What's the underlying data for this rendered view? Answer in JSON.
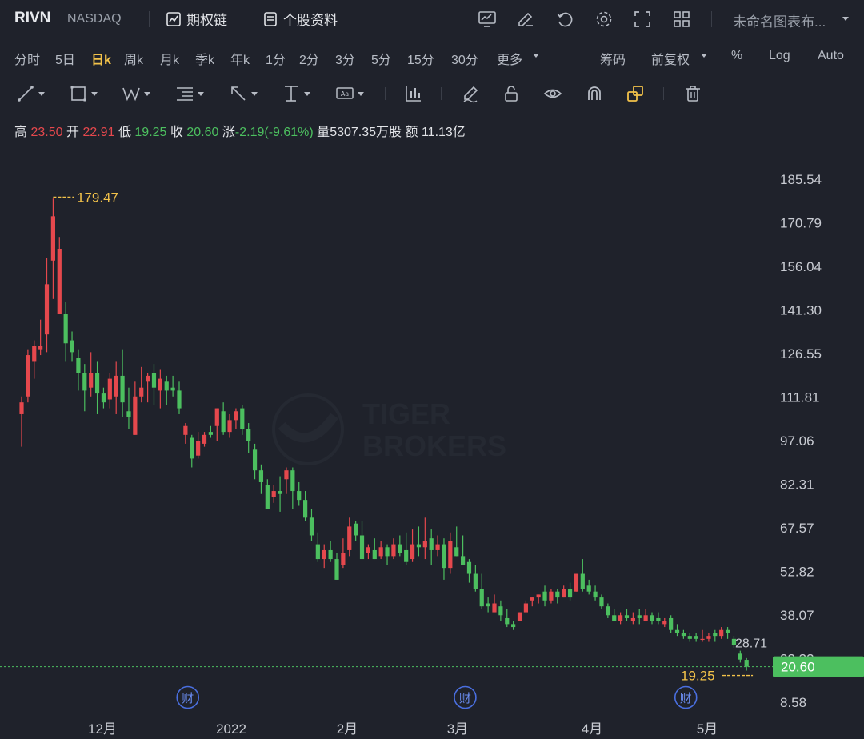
{
  "header": {
    "ticker": "RIVN",
    "exchange": "NASDAQ",
    "options_chain_label": "期权链",
    "profile_label": "个股资料",
    "chart_name": "未命名图表布..."
  },
  "periods": {
    "items": [
      "分时",
      "5日",
      "日k",
      "周k",
      "月k",
      "季k",
      "年k",
      "1分",
      "2分",
      "3分",
      "5分",
      "15分",
      "30分",
      "更多"
    ],
    "active": "日k"
  },
  "right_options": {
    "chips": "筹码",
    "adjust": "前复权",
    "percent": "%",
    "log": "Log",
    "auto": "Auto"
  },
  "quote": {
    "high_label": "高",
    "high": "23.50",
    "open_label": "开",
    "open": "22.91",
    "low_label": "低",
    "low": "19.25",
    "close_label": "收",
    "close": "20.60",
    "change_label": "涨",
    "change": "-2.19(-9.61%)",
    "volume_label": "量",
    "volume": "5307.35万股",
    "amount_label": "额",
    "amount": "11.13亿"
  },
  "colors": {
    "up": "#e5484d",
    "down": "#4cbf5f",
    "highlight": "#f2c24a",
    "accent": "#f2c24a"
  },
  "watermark": {
    "line1": "TIGER",
    "line2": "BROKERS"
  },
  "chart_data": {
    "type": "candlestick",
    "y_ticks": [
      "185.54",
      "170.79",
      "156.04",
      "141.30",
      "126.55",
      "111.81",
      "97.06",
      "82.31",
      "67.57",
      "52.82",
      "38.07",
      "23.33",
      "8.58"
    ],
    "ylim": [
      8.58,
      185.54
    ],
    "x_ticks": [
      "12月",
      "2022",
      "2月",
      "3月",
      "4月",
      "5月"
    ],
    "max_label": "179.47",
    "min_label": "19.25",
    "last_price": "20.60",
    "side_label": "28.71",
    "event_marker": "财",
    "event_x_indices": [
      19,
      63,
      98
    ],
    "candles": [
      [
        106,
        110,
        95,
        112
      ],
      [
        112,
        126,
        110,
        128
      ],
      [
        124,
        129,
        118,
        131
      ],
      [
        128,
        129,
        126,
        138
      ],
      [
        133,
        150,
        127,
        159
      ],
      [
        158,
        173,
        145,
        179
      ],
      [
        140,
        162,
        140,
        166
      ],
      [
        140,
        130,
        124,
        144
      ],
      [
        131,
        127,
        124,
        134
      ],
      [
        125,
        120,
        114,
        128
      ],
      [
        120,
        114,
        107,
        123
      ],
      [
        115,
        120,
        112,
        127
      ],
      [
        120,
        113,
        106,
        124
      ],
      [
        113,
        110,
        108,
        115
      ],
      [
        111,
        118,
        108,
        120
      ],
      [
        112,
        119,
        106,
        124
      ],
      [
        119,
        110,
        105,
        128
      ],
      [
        107,
        105,
        101,
        115
      ],
      [
        99,
        112,
        99,
        117
      ],
      [
        112,
        115,
        110,
        122
      ],
      [
        117,
        119,
        110,
        120
      ],
      [
        120,
        115,
        109,
        123
      ],
      [
        114,
        118,
        108,
        121
      ],
      [
        117,
        114,
        109,
        119
      ],
      [
        115,
        114,
        112,
        119
      ],
      [
        114,
        108,
        106,
        117
      ],
      [
        99,
        102,
        96,
        103
      ],
      [
        98,
        91,
        88,
        99
      ],
      [
        92,
        97,
        91,
        100
      ],
      [
        96,
        99,
        95,
        100
      ],
      [
        100,
        99,
        98,
        102
      ],
      [
        102,
        108,
        97,
        108
      ],
      [
        107,
        100,
        99,
        110
      ],
      [
        100,
        104,
        98,
        106
      ],
      [
        104,
        107,
        101,
        108
      ],
      [
        108,
        101,
        99,
        109
      ],
      [
        101,
        97,
        93,
        103
      ],
      [
        94,
        87,
        84,
        96
      ],
      [
        87,
        83,
        79,
        89
      ],
      [
        82,
        74,
        74,
        84
      ],
      [
        78,
        80,
        76,
        82
      ],
      [
        80,
        79,
        73,
        85
      ],
      [
        84,
        87,
        79,
        88
      ],
      [
        87,
        80,
        74,
        88
      ],
      [
        80,
        77,
        75,
        83
      ],
      [
        77,
        71,
        70,
        80
      ],
      [
        71,
        65,
        63,
        74
      ],
      [
        62,
        57,
        56,
        66
      ],
      [
        57,
        60,
        54,
        62
      ],
      [
        60,
        57,
        56,
        63
      ],
      [
        57,
        50,
        50,
        59
      ],
      [
        55,
        59,
        54,
        64
      ],
      [
        60,
        68,
        58,
        71
      ],
      [
        69,
        65,
        63,
        70
      ],
      [
        65,
        57,
        57,
        70
      ],
      [
        59,
        61,
        57,
        62
      ],
      [
        60,
        57,
        57,
        64
      ],
      [
        58,
        61,
        57,
        63
      ],
      [
        61,
        58,
        55,
        62
      ],
      [
        58,
        62,
        57,
        64
      ],
      [
        62,
        59,
        58,
        65
      ],
      [
        60,
        56,
        55,
        66
      ],
      [
        57,
        62,
        56,
        67
      ],
      [
        62,
        61,
        58,
        68
      ],
      [
        61,
        63,
        57,
        71
      ],
      [
        64,
        60,
        55,
        67
      ],
      [
        60,
        62,
        58,
        65
      ],
      [
        62,
        54,
        50,
        64
      ],
      [
        54,
        63,
        52,
        66
      ],
      [
        61,
        58,
        58,
        68
      ],
      [
        58,
        55,
        55,
        65
      ],
      [
        56,
        52,
        49,
        57
      ],
      [
        52,
        47,
        46,
        55
      ],
      [
        47,
        41,
        40,
        52
      ],
      [
        42,
        41,
        39,
        44
      ],
      [
        39,
        42,
        39,
        45
      ],
      [
        41,
        38,
        36,
        43
      ],
      [
        37,
        35,
        34,
        40
      ],
      [
        35,
        34,
        33,
        36
      ],
      [
        36,
        39,
        36,
        39
      ],
      [
        39,
        42,
        39,
        43
      ],
      [
        43,
        44,
        41,
        44
      ],
      [
        44,
        45,
        42,
        45
      ],
      [
        46,
        43,
        41,
        48
      ],
      [
        43,
        46,
        42,
        47
      ],
      [
        46,
        44,
        42,
        47
      ],
      [
        44,
        47,
        44,
        48
      ],
      [
        47,
        44,
        43,
        49
      ],
      [
        46,
        52,
        46,
        52
      ],
      [
        52,
        47,
        46,
        57
      ],
      [
        48,
        46,
        45,
        50
      ],
      [
        46,
        44,
        43,
        48
      ],
      [
        44,
        41,
        40,
        45
      ],
      [
        41,
        38,
        37,
        42
      ],
      [
        38,
        36,
        36,
        40
      ],
      [
        36,
        38,
        35,
        39
      ],
      [
        38,
        37,
        36,
        40
      ],
      [
        36,
        37,
        35,
        39
      ],
      [
        38,
        37,
        35,
        40
      ],
      [
        36,
        38,
        36,
        40
      ],
      [
        38,
        36,
        35,
        39
      ],
      [
        37,
        36,
        35,
        39
      ],
      [
        35,
        36,
        34,
        37
      ],
      [
        37,
        33,
        32,
        38
      ],
      [
        33,
        32,
        31,
        35
      ],
      [
        32,
        31,
        30,
        33
      ],
      [
        31,
        30,
        29,
        32
      ],
      [
        31,
        30,
        29,
        32
      ],
      [
        30,
        30,
        29,
        33
      ],
      [
        30,
        31,
        29,
        32
      ],
      [
        32,
        31,
        29,
        33
      ],
      [
        31,
        33,
        30,
        34
      ],
      [
        33,
        32,
        30,
        34
      ],
      [
        30,
        28,
        27,
        31
      ],
      [
        25,
        23,
        22,
        26
      ],
      [
        22.91,
        20.6,
        19.25,
        23.5
      ]
    ],
    "last_index": 116
  }
}
